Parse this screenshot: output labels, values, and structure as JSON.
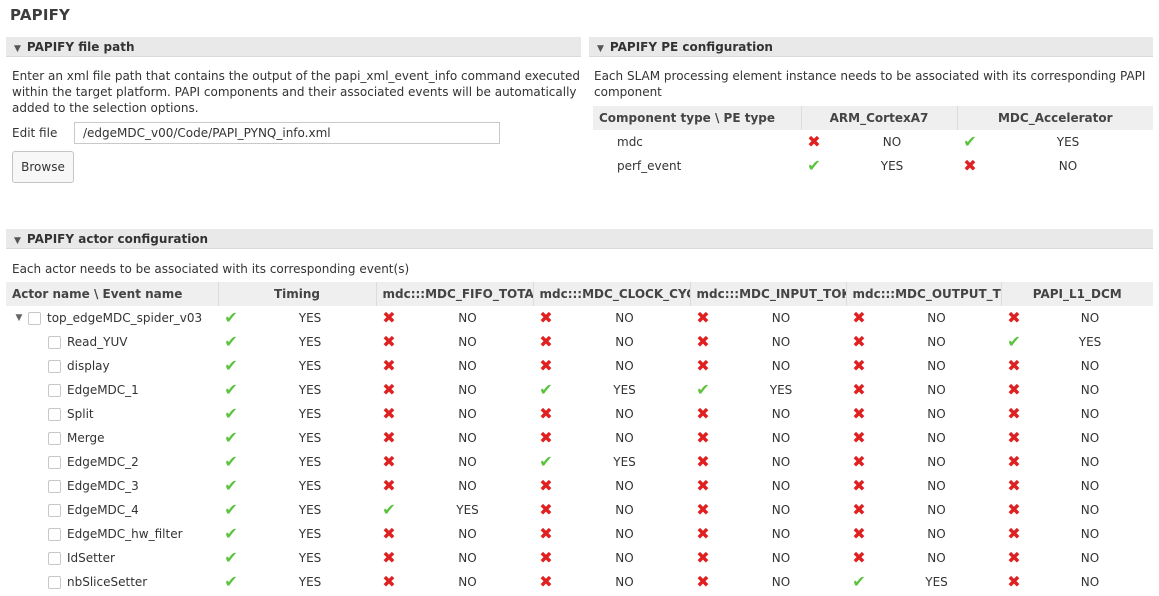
{
  "page_title": "PAPIFY",
  "file_path_section": {
    "header": "PAPIFY file path",
    "description_lines": [
      "Enter an xml file path that contains the output of the papi_xml_event_info command executed",
      "within the target platform. PAPI components and their associated events will be automatically",
      "added to the selection options."
    ],
    "edit_label": "Edit file",
    "edit_value": "/edgeMDC_v00/Code/PAPI_PYNQ_info.xml",
    "browse_label": "Browse"
  },
  "pe_section": {
    "header": "PAPIFY PE configuration",
    "description_lines": [
      "Each SLAM processing element instance needs to be associated with its corresponding PAPI",
      "component"
    ],
    "columns": [
      "Component type \\ PE type",
      "ARM_CortexA7",
      "MDC_Accelerator"
    ],
    "rows": [
      {
        "name": "mdc",
        "values": [
          "NO",
          "YES"
        ]
      },
      {
        "name": "perf_event",
        "values": [
          "YES",
          "NO"
        ]
      }
    ]
  },
  "actor_section": {
    "header": "PAPIFY actor configuration",
    "description": "Each actor needs to be associated with its corresponding event(s)",
    "columns": [
      "Actor name \\ Event name",
      "Timing",
      "mdc:::MDC_FIFO_TOTAL_",
      "mdc:::MDC_CLOCK_CYCL",
      "mdc:::MDC_INPUT_TOKE",
      "mdc:::MDC_OUTPUT_TOI",
      "PAPI_L1_DCM"
    ],
    "rows": [
      {
        "name": "top_edgeMDC_spider_v03",
        "expanded": true,
        "values": [
          "YES",
          "NO",
          "NO",
          "NO",
          "NO",
          "NO"
        ]
      },
      {
        "name": "Read_YUV",
        "values": [
          "YES",
          "NO",
          "NO",
          "NO",
          "NO",
          "YES"
        ]
      },
      {
        "name": "display",
        "values": [
          "YES",
          "NO",
          "NO",
          "NO",
          "NO",
          "NO"
        ]
      },
      {
        "name": "EdgeMDC_1",
        "values": [
          "YES",
          "NO",
          "YES",
          "YES",
          "NO",
          "NO"
        ]
      },
      {
        "name": "Split",
        "values": [
          "YES",
          "NO",
          "NO",
          "NO",
          "NO",
          "NO"
        ]
      },
      {
        "name": "Merge",
        "values": [
          "YES",
          "NO",
          "NO",
          "NO",
          "NO",
          "NO"
        ]
      },
      {
        "name": "EdgeMDC_2",
        "values": [
          "YES",
          "NO",
          "YES",
          "NO",
          "NO",
          "NO"
        ]
      },
      {
        "name": "EdgeMDC_3",
        "values": [
          "YES",
          "NO",
          "NO",
          "NO",
          "NO",
          "NO"
        ]
      },
      {
        "name": "EdgeMDC_4",
        "values": [
          "YES",
          "YES",
          "NO",
          "NO",
          "NO",
          "NO"
        ]
      },
      {
        "name": "EdgeMDC_hw_filter",
        "values": [
          "YES",
          "NO",
          "NO",
          "NO",
          "NO",
          "NO"
        ]
      },
      {
        "name": "IdSetter",
        "values": [
          "YES",
          "NO",
          "NO",
          "NO",
          "NO",
          "NO"
        ]
      },
      {
        "name": "nbSliceSetter",
        "values": [
          "YES",
          "NO",
          "NO",
          "NO",
          "YES",
          "NO"
        ]
      }
    ]
  },
  "icons": {
    "yes": "check-icon",
    "no": "cross-icon"
  },
  "colors": {
    "yes": "#5cc33c",
    "no": "#e02020",
    "header_bg": "#e9e9e9"
  }
}
